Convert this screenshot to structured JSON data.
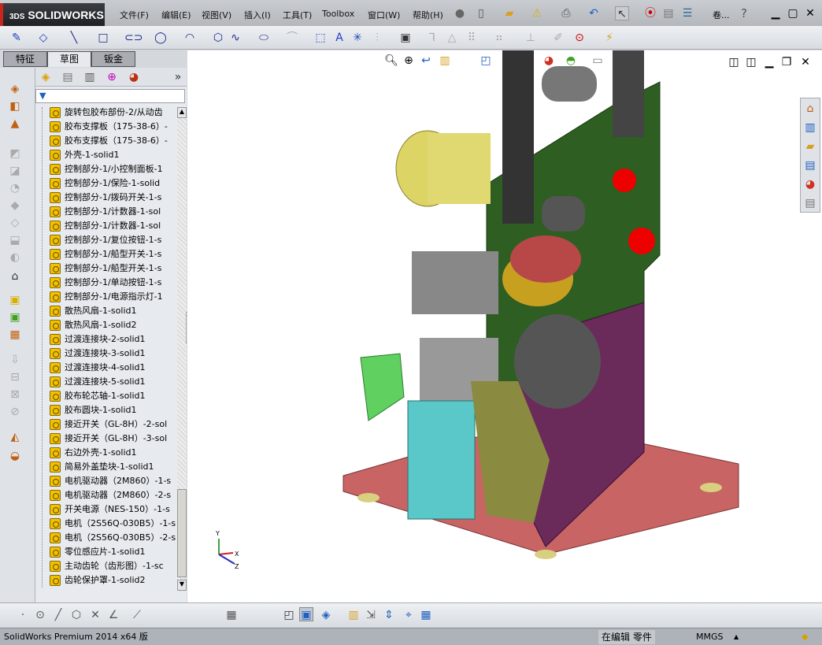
{
  "app": {
    "logo": "SOLIDWORKS",
    "logo_prefix": "3DS"
  },
  "menu": [
    "文件(F)",
    "编辑(E)",
    "视图(V)",
    "插入(I)",
    "工具(T)",
    "Toolbox",
    "窗口(W)",
    "帮助(H)"
  ],
  "title_toolbar": {
    "truncated_label": "卷...",
    "help": "?"
  },
  "panel_tabs": [
    "特征",
    "草图",
    "钣金"
  ],
  "active_tab": "草图",
  "tree_items": [
    "旋转包胶布部份-2/从动齿",
    "胶布支撑板（175-38-6）-",
    "胶布支撑板（175-38-6）-",
    "外壳-1-solid1",
    "控制部分-1/小控制面板-1",
    "控制部分-1/保险-1-solid",
    "控制部分-1/拨码开关-1-s",
    "控制部分-1/计数器-1-sol",
    "控制部分-1/计数器-1-sol",
    "控制部分-1/复位按钮-1-s",
    "控制部分-1/船型开关-1-s",
    "控制部分-1/船型开关-1-s",
    "控制部分-1/单动按钮-1-s",
    "控制部分-1/电源指示灯-1",
    "散热风扇-1-solid1",
    "散热风扇-1-solid2",
    "过渡连接块-2-solid1",
    "过渡连接块-3-solid1",
    "过渡连接块-4-solid1",
    "过渡连接块-5-solid1",
    "胶布轮芯轴-1-solid1",
    "胶布圆块-1-solid1",
    "接近开关（GL-8H）-2-sol",
    "接近开关（GL-8H）-3-sol",
    "右边外壳-1-solid1",
    "简易外盖垫块-1-solid1",
    "电机驱动器（2M860）-1-s",
    "电机驱动器（2M860）-2-s",
    "开关电源（NES-150）-1-s",
    "电机（2S56Q-030B5）-1-s",
    "电机（2S56Q-030B5）-2-s",
    "零位感应片-1-solid1",
    "主动齿轮（齿形图）-1-sc",
    "齿轮保护罩-1-solid2"
  ],
  "triad": {
    "x": "X",
    "y": "Y",
    "z": "Z"
  },
  "status": {
    "version": "SolidWorks Premium 2014 x64 版",
    "mode": "在编辑 零件",
    "units": "MMGS"
  },
  "colors": {
    "accent": "#c8261c",
    "plate": "#2e5e22",
    "base": "#c86464",
    "purple": "#6a2a5a",
    "cyan": "#5ac8c8"
  }
}
